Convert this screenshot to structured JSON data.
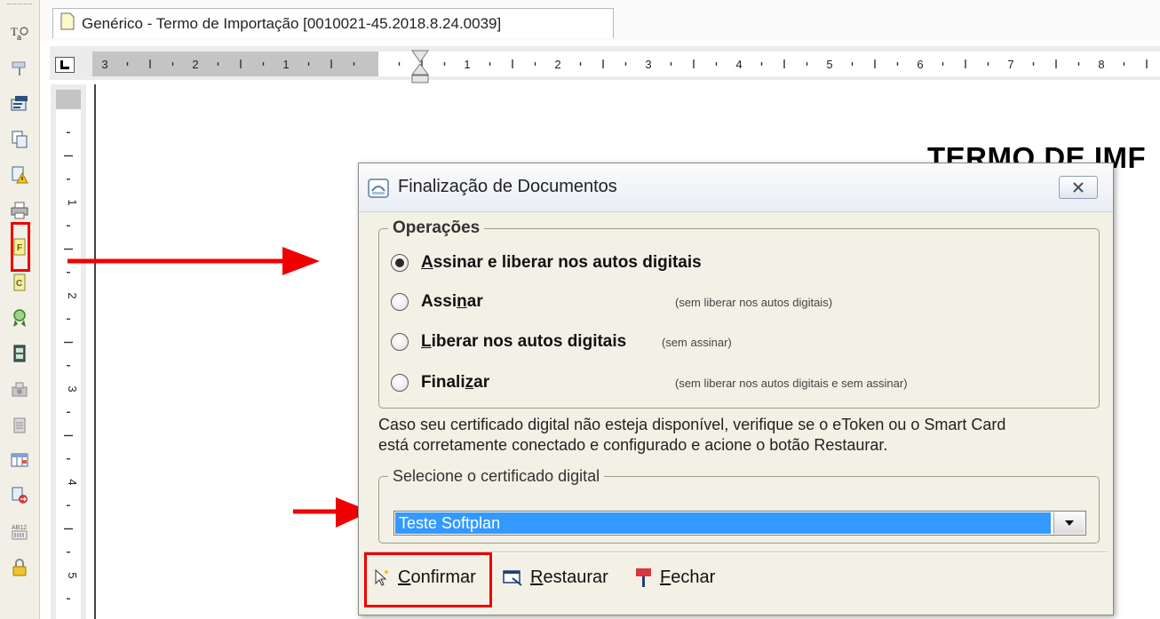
{
  "tab": {
    "title": "Genérico - Termo de Importação [0010021-45.2018.8.24.0039]"
  },
  "ruler": {
    "labels": [
      "3",
      "2",
      "1",
      "1",
      "2",
      "3",
      "4",
      "5",
      "6",
      "7",
      "8"
    ],
    "vertical_labels": [
      "1",
      "2",
      "3",
      "4",
      "5"
    ]
  },
  "document": {
    "heading": "TERMO DE IMF"
  },
  "toolbar": {
    "icons": [
      "text-format-icon",
      "paint-icon",
      "form-icon",
      "copy-page-icon",
      "warning-doc-icon",
      "print-icon",
      "finalize-f-icon",
      "c-doc-icon",
      "certificate-ribbon-icon",
      "film-icon",
      "gray-tool-icon",
      "gray-doc-icon",
      "table-icon",
      "convert-icon",
      "barcode-print-icon",
      "lock-icon"
    ]
  },
  "dialog": {
    "title": "Finalização de Documentos",
    "operations_legend": "Operações",
    "options": [
      {
        "label_pre": "",
        "label_u": "A",
        "label_post": "ssinar e liberar nos autos digitais",
        "hint": "",
        "checked": true
      },
      {
        "label_pre": "Assi",
        "label_u": "n",
        "label_post": "ar",
        "hint": "(sem liberar nos autos digitais)",
        "checked": false
      },
      {
        "label_pre": "",
        "label_u": "L",
        "label_post": "iberar nos autos digitais",
        "hint": "(sem assinar)",
        "checked": false
      },
      {
        "label_pre": "Finali",
        "label_u": "z",
        "label_post": "ar",
        "hint": "(sem liberar nos autos digitais e sem assinar)",
        "checked": false
      }
    ],
    "info_line1": "Caso seu certificado digital não esteja disponível, verifique se o eToken ou o Smart Card",
    "info_line2": "está corretamente conectado e configurado e acione o botão Restaurar.",
    "cert_legend": "Selecione o certificado digital",
    "cert_value": "Teste Softplan",
    "buttons": {
      "confirm_u": "C",
      "confirm_rest": "onfirmar",
      "restore_u": "R",
      "restore_rest": "estaurar",
      "close_u": "F",
      "close_rest": "echar"
    }
  },
  "colors": {
    "highlight": "#e00000",
    "selection": "#3399ff",
    "dialog_bg": "#f3f1e6"
  }
}
